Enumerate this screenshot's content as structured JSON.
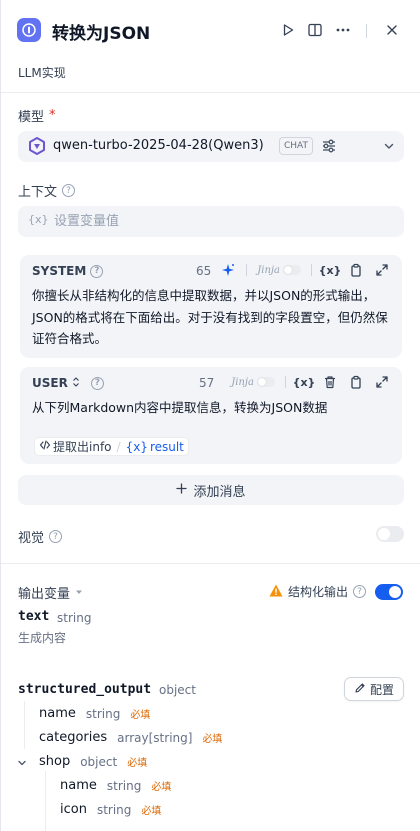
{
  "header": {
    "title": "转换为JSON",
    "description": "LLM实现"
  },
  "model": {
    "label": "模型",
    "required_mark": "*",
    "name": "qwen-turbo-2025-04-28(Qwen3)",
    "badge": "CHAT"
  },
  "context": {
    "label": "上下文",
    "var_icon": "{x}",
    "placeholder": "设置变量值"
  },
  "messages": [
    {
      "role": "SYSTEM",
      "count": "65",
      "jinja": "Jinja",
      "text": "你擅长从非结构化的信息中提取数据，并以JSON的形式输出，JSON的格式将在下面给出。对于没有找到的字段置空，但仍然保证符合格式。"
    },
    {
      "role": "USER",
      "count": "57",
      "jinja": "Jinja",
      "text": "从下列Markdown内容中提取信息，转换为JSON数据",
      "chip_node": "提取出info",
      "chip_var": "result"
    }
  ],
  "add_message_label": "添加消息",
  "vision": {
    "label": "视觉",
    "enabled": false
  },
  "output": {
    "label": "输出变量",
    "structured_label": "结构化输出",
    "structured_enabled": true,
    "vars": [
      {
        "name": "text",
        "type": "string",
        "desc": "生成内容"
      },
      {
        "name": "structured_output",
        "type": "object"
      }
    ],
    "config_label": "配置",
    "fields": [
      {
        "name": "name",
        "type": "string",
        "req": "必填"
      },
      {
        "name": "categories",
        "type": "array[string]",
        "req": "必填"
      },
      {
        "name": "shop",
        "type": "object",
        "req": "必填"
      },
      {
        "name": "name",
        "type": "string",
        "req": "必填"
      },
      {
        "name": "icon",
        "type": "string",
        "req": "必填"
      }
    ]
  },
  "colors": {
    "accent": "#155eef",
    "app_icon": "#6172f3",
    "required": "#dc6803",
    "warning": "#f79009"
  }
}
